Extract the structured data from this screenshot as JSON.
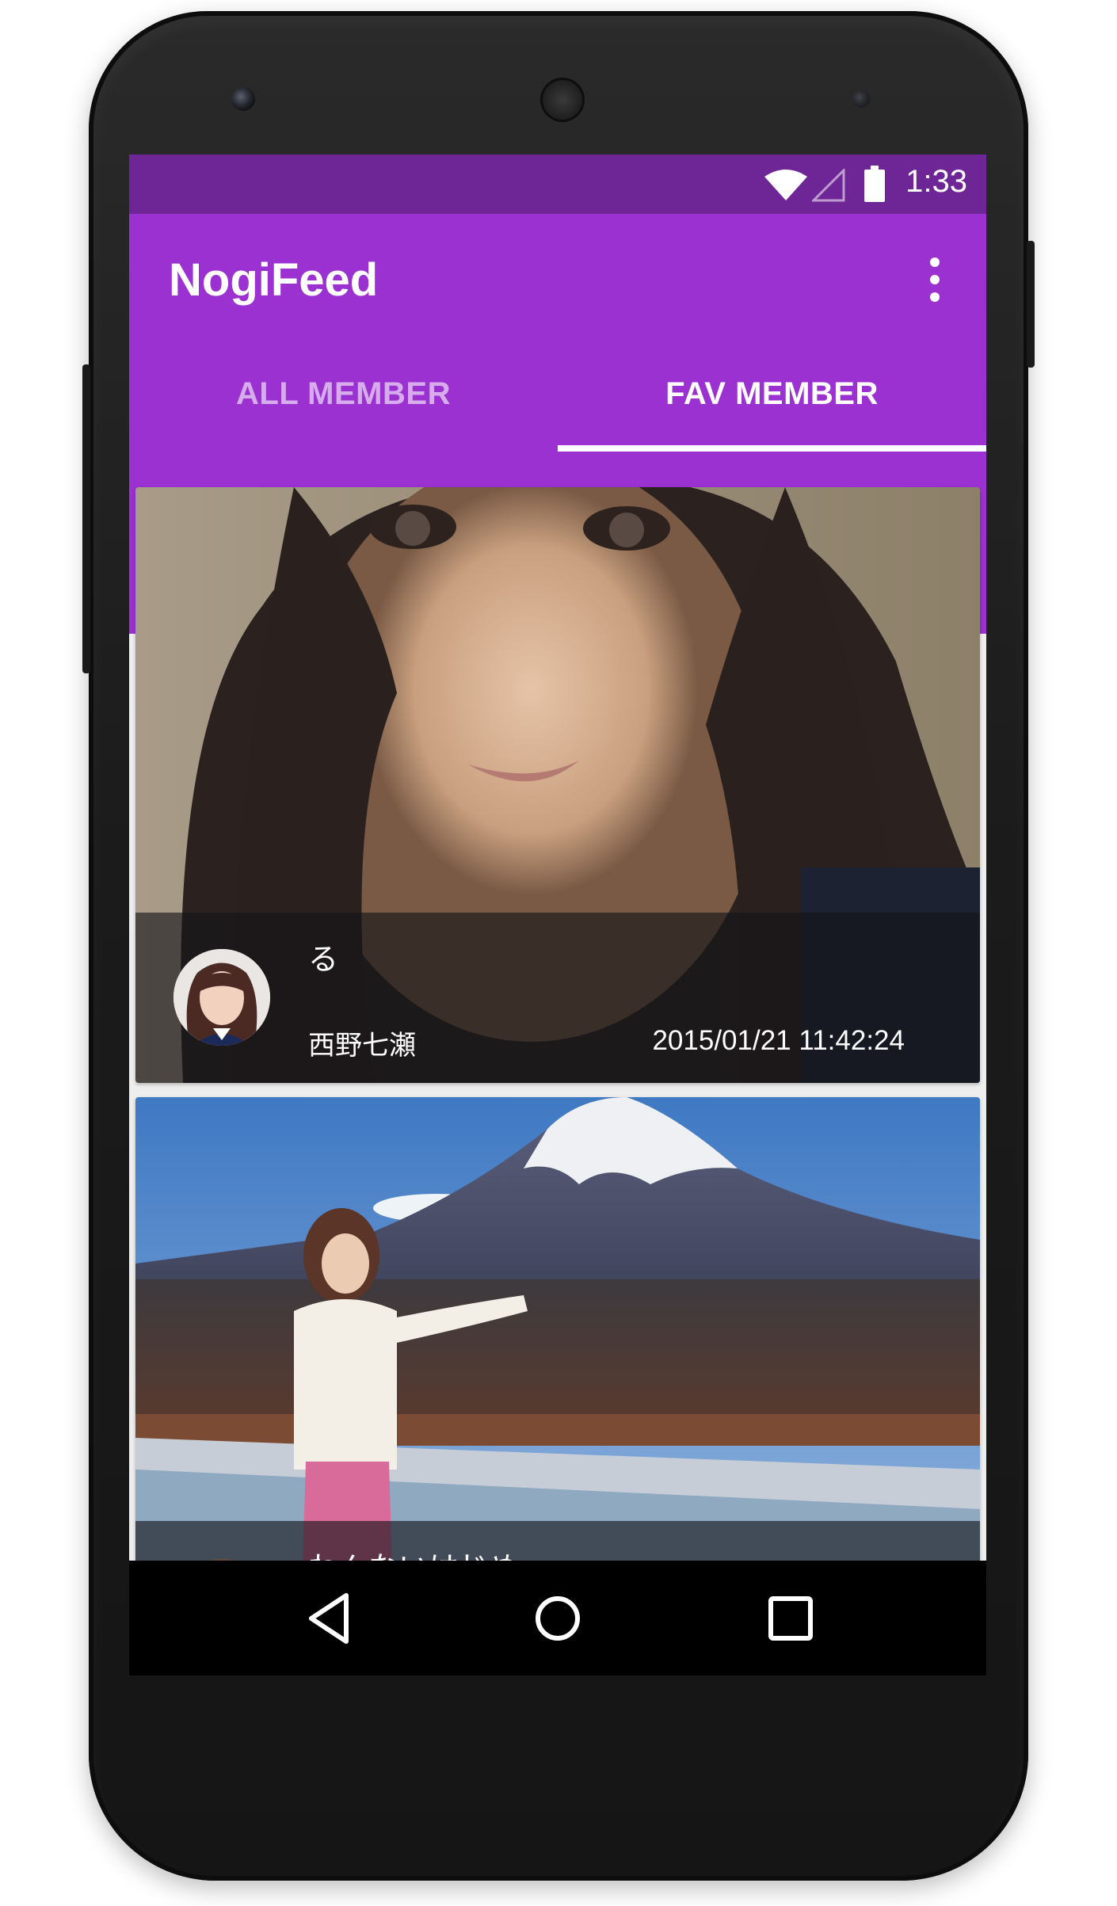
{
  "statusbar": {
    "time": "1:33"
  },
  "appbar": {
    "title": "NogiFeed",
    "overflow_icon": "overflow-menu-icon"
  },
  "tabs": [
    {
      "label": "ALL MEMBER",
      "active": false
    },
    {
      "label": "FAV MEMBER",
      "active": true
    }
  ],
  "feed": {
    "items": [
      {
        "title": "る",
        "author": "西野七瀬",
        "date": "2015/01/21 11:42:24"
      },
      {
        "title": "わんないはじめ",
        "author": "",
        "date": ""
      }
    ]
  },
  "navbar": {
    "back_icon": "back-icon",
    "home_icon": "home-icon",
    "recents_icon": "recents-icon"
  },
  "colors": {
    "status_bar": "#6e2595",
    "app_bar": "#9b31d1",
    "tab_indicator": "#ffffff",
    "background": "#eeeeee",
    "nav_bar": "#000000"
  }
}
